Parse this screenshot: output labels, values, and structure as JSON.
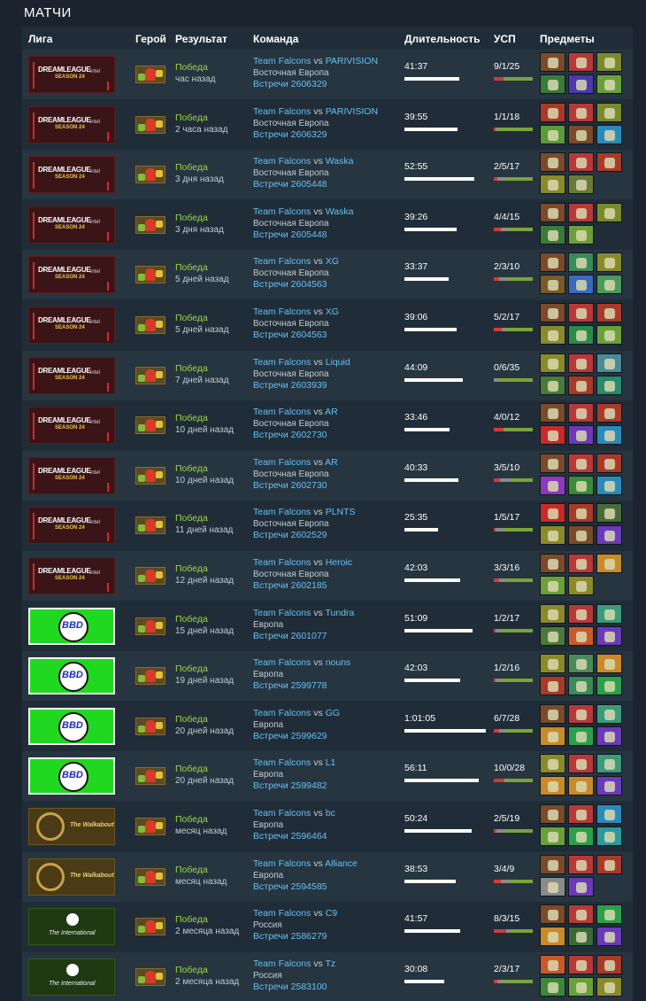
{
  "section_title": "МАТЧИ",
  "headers": {
    "league": "Лига",
    "hero": "Герой",
    "result": "Результат",
    "team": "Команда",
    "duration": "Длительность",
    "kda": "УСП",
    "items": "Предметы"
  },
  "team_name": "Team Falcons",
  "vs_label": "vs",
  "leagues": {
    "dream": {
      "line1": "DREAMLEAGUE",
      "line2": "SEASON 24",
      "sponsor": "intel"
    },
    "bbd": {
      "text": "BBD"
    },
    "walk": {
      "text": "The Walkabout"
    },
    "ti": {
      "text": "The International"
    }
  },
  "matches": [
    {
      "league": "dream",
      "result": "Победа",
      "time": "час назад",
      "opponent": "PARIVISION",
      "region": "Восточная Европа",
      "match": "Встречи 2606329",
      "duration": "41:37",
      "duration_s": 2497,
      "kda": "9/1/25",
      "k": 9,
      "d": 1,
      "a": 25,
      "items": [
        "#7a4a2a",
        "#b8383a",
        "#7a8a2a",
        "#3a7a3a",
        "#4a3aaa",
        "#6aa03a"
      ]
    },
    {
      "league": "dream",
      "result": "Победа",
      "time": "2 часа назад",
      "opponent": "PARIVISION",
      "region": "Восточная Европа",
      "match": "Встречи 2606329",
      "duration": "39:55",
      "duration_s": 2395,
      "kda": "1/1/18",
      "k": 1,
      "d": 1,
      "a": 18,
      "items": [
        "#a83a2a",
        "#b8383a",
        "#7a8a2a",
        "#5a9a3a",
        "#7a4a2a",
        "#2a8aba"
      ]
    },
    {
      "league": "dream",
      "result": "Победа",
      "time": "3 дня назад",
      "opponent": "Waska",
      "region": "Восточная Европа",
      "match": "Встречи 2605448",
      "duration": "52:55",
      "duration_s": 3175,
      "kda": "2/5/17",
      "k": 2,
      "d": 5,
      "a": 17,
      "items": [
        "#7a4a2a",
        "#b8383a",
        "#a83a2a",
        "#8a8a2a",
        "#6a7a3a"
      ]
    },
    {
      "league": "dream",
      "result": "Победа",
      "time": "3 дня назад",
      "opponent": "Waska",
      "region": "Восточная Европа",
      "match": "Встречи 2605448",
      "duration": "39:26",
      "duration_s": 2366,
      "kda": "4/4/15",
      "k": 4,
      "d": 4,
      "a": 15,
      "items": [
        "#7a4a2a",
        "#b8383a",
        "#7a8a2a",
        "#3a7a3a",
        "#6aa03a"
      ]
    },
    {
      "league": "dream",
      "result": "Победа",
      "time": "5 дней назад",
      "opponent": "XG",
      "region": "Восточная Европа",
      "match": "Встречи 2604563",
      "duration": "33:37",
      "duration_s": 2017,
      "kda": "2/3/10",
      "k": 2,
      "d": 3,
      "a": 10,
      "items": [
        "#7a4a2a",
        "#3a8a5a",
        "#8a8a2a",
        "#7a5a2a",
        "#3a6aba",
        "#4a9a5a"
      ]
    },
    {
      "league": "dream",
      "result": "Победа",
      "time": "5 дней назад",
      "opponent": "XG",
      "region": "Восточная Европа",
      "match": "Встречи 2604563",
      "duration": "39:06",
      "duration_s": 2346,
      "kda": "5/2/17",
      "k": 5,
      "d": 2,
      "a": 17,
      "items": [
        "#7a4a2a",
        "#b8383a",
        "#a83a2a",
        "#8a8a2a",
        "#2a8a4a",
        "#6aa03a"
      ]
    },
    {
      "league": "dream",
      "result": "Победа",
      "time": "7 дней назад",
      "opponent": "Liquid",
      "region": "Восточная Европа",
      "match": "Встречи 2603939",
      "duration": "44:09",
      "duration_s": 2649,
      "kda": "0/6/35",
      "k": 0,
      "d": 6,
      "a": 35,
      "items": [
        "#8a8a2a",
        "#b8383a",
        "#4a8a9a",
        "#4a7a3a",
        "#a83a2a",
        "#2a8a6a"
      ]
    },
    {
      "league": "dream",
      "result": "Победа",
      "time": "10 дней назад",
      "opponent": "AR",
      "region": "Восточная Европа",
      "match": "Встречи 2602730",
      "duration": "33:46",
      "duration_s": 2026,
      "kda": "4/0/12",
      "k": 4,
      "d": 0,
      "a": 12,
      "items": [
        "#7a4a2a",
        "#b8383a",
        "#a83a2a",
        "#c82a2a",
        "#6a3aba",
        "#2a8aba"
      ]
    },
    {
      "league": "dream",
      "result": "Победа",
      "time": "10 дней назад",
      "opponent": "AR",
      "region": "Восточная Европа",
      "match": "Встречи 2602730",
      "duration": "40:33",
      "duration_s": 2433,
      "kda": "3/5/10",
      "k": 3,
      "d": 5,
      "a": 10,
      "items": [
        "#7a4a2a",
        "#b8383a",
        "#a83a2a",
        "#8a3aba",
        "#3a8a3a",
        "#2a8aba"
      ]
    },
    {
      "league": "dream",
      "result": "Победа",
      "time": "11 дней назад",
      "opponent": "PLNTS",
      "region": "Восточная Европа",
      "match": "Встречи 2602529",
      "duration": "25:35",
      "duration_s": 1535,
      "kda": "1/5/17",
      "k": 1,
      "d": 5,
      "a": 17,
      "items": [
        "#c82a2a",
        "#a83a2a",
        "#4a6a3a",
        "#8a8a2a",
        "#7a4a2a",
        "#6a3aba"
      ]
    },
    {
      "league": "dream",
      "result": "Победа",
      "time": "12 дней назад",
      "opponent": "Heroic",
      "region": "Восточная Европа",
      "match": "Встречи 2602185",
      "duration": "42:03",
      "duration_s": 2523,
      "kda": "3/3/16",
      "k": 3,
      "d": 3,
      "a": 16,
      "items": [
        "#7a4a2a",
        "#b8383a",
        "#c88a2a",
        "#6aa03a",
        "#8a8a2a"
      ]
    },
    {
      "league": "bbd",
      "result": "Победа",
      "time": "15 дней назад",
      "opponent": "Tundra",
      "region": "Европа",
      "match": "Встречи 2601077",
      "duration": "51:09",
      "duration_s": 3069,
      "kda": "1/2/17",
      "k": 1,
      "d": 2,
      "a": 17,
      "items": [
        "#8a8a2a",
        "#b8383a",
        "#3a9a7a",
        "#4a7a3a",
        "#c85a2a",
        "#6a3aba"
      ]
    },
    {
      "league": "bbd",
      "result": "Победа",
      "time": "19 дней назад",
      "opponent": "nouns",
      "region": "Европа",
      "match": "Встречи 2599778",
      "duration": "42:03",
      "duration_s": 2523,
      "kda": "1/2/16",
      "k": 1,
      "d": 2,
      "a": 16,
      "items": [
        "#8a8a2a",
        "#4a8a5a",
        "#c88a2a",
        "#a83a2a",
        "#3a8a5a",
        "#2aa04a"
      ]
    },
    {
      "league": "bbd",
      "result": "Победа",
      "time": "20 дней назад",
      "opponent": "GG",
      "region": "Европа",
      "match": "Встречи 2599629",
      "duration": "1:01:05",
      "duration_s": 3665,
      "kda": "6/7/28",
      "k": 6,
      "d": 7,
      "a": 28,
      "items": [
        "#7a4a2a",
        "#b8383a",
        "#3a9a7a",
        "#c88a2a",
        "#2aa04a",
        "#6a3aba"
      ]
    },
    {
      "league": "bbd",
      "result": "Победа",
      "time": "20 дней назад",
      "opponent": "L1",
      "region": "Европа",
      "match": "Встречи 2599482",
      "duration": "56:11",
      "duration_s": 3371,
      "kda": "10/0/28",
      "k": 10,
      "d": 0,
      "a": 28,
      "items": [
        "#8a8a2a",
        "#b8383a",
        "#3a9a7a",
        "#c88a2a",
        "#c88a2a",
        "#6a3aba"
      ]
    },
    {
      "league": "walk",
      "result": "Победа",
      "time": "месяц назад",
      "opponent": "bc",
      "region": "Европа",
      "match": "Встречи 2596464",
      "duration": "50:24",
      "duration_s": 3024,
      "kda": "2/5/19",
      "k": 2,
      "d": 5,
      "a": 19,
      "items": [
        "#7a4a2a",
        "#b8383a",
        "#2a8aba",
        "#6aa03a",
        "#2aa04a",
        "#2a9a9a"
      ]
    },
    {
      "league": "walk",
      "result": "Победа",
      "time": "месяц назад",
      "opponent": "Alliance",
      "region": "Европа",
      "match": "Встречи 2594585",
      "duration": "38:53",
      "duration_s": 2333,
      "kda": "3/4/9",
      "k": 3,
      "d": 4,
      "a": 9,
      "items": [
        "#7a4a2a",
        "#b8383a",
        "#a83a2a",
        "#8a8a8a",
        "#6a3aba"
      ]
    },
    {
      "league": "ti",
      "result": "Победа",
      "time": "2 месяца назад",
      "opponent": "C9",
      "region": "Россия",
      "match": "Встречи 2586279",
      "duration": "41:57",
      "duration_s": 2517,
      "kda": "8/3/15",
      "k": 8,
      "d": 3,
      "a": 15,
      "items": [
        "#7a4a2a",
        "#b8383a",
        "#2aa04a",
        "#c88a2a",
        "#3a6a3a",
        "#6a3aba"
      ]
    },
    {
      "league": "ti",
      "result": "Победа",
      "time": "2 месяца назад",
      "opponent": "Tz",
      "region": "Россия",
      "match": "Встречи 2583100",
      "duration": "30:08",
      "duration_s": 1808,
      "kda": "2/3/17",
      "k": 2,
      "d": 3,
      "a": 17,
      "items": [
        "#c85a2a",
        "#b8383a",
        "#a83a2a",
        "#3a8a3a",
        "#6aa03a",
        "#8a8a2a"
      ]
    }
  ]
}
